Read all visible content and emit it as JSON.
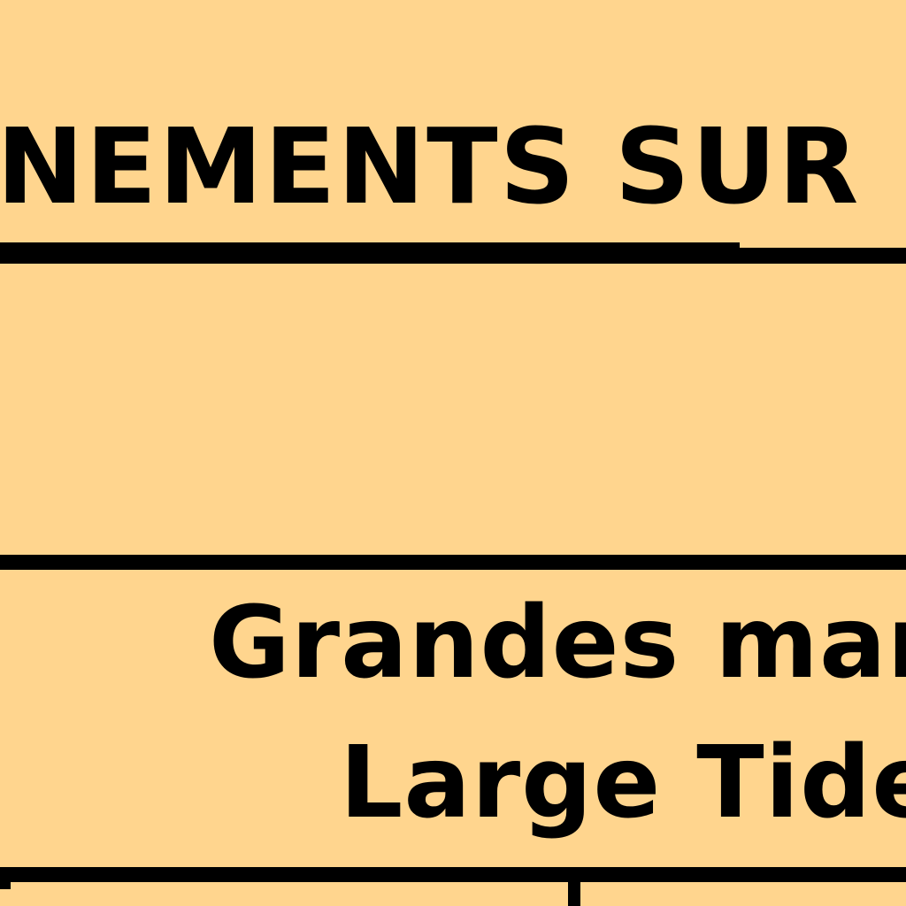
{
  "section": {
    "heading": "NEMENTS SUR LI"
  },
  "row": {
    "french_label": "Grandes maré",
    "english_label": "Large Tides"
  }
}
